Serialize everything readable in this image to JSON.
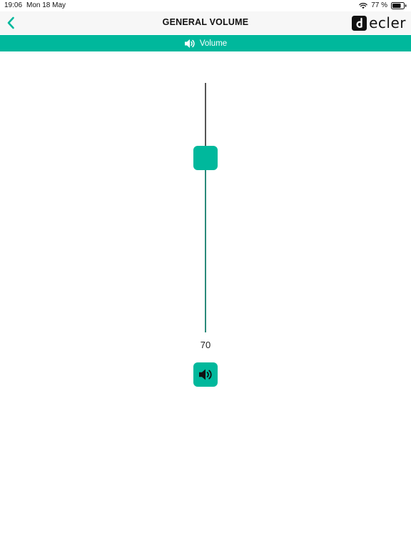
{
  "status_bar": {
    "time": "19:06",
    "date": "Mon 18 May",
    "battery_text": "77 %",
    "battery_level": 0.77,
    "icons": [
      "wifi-icon",
      "battery-icon"
    ]
  },
  "nav": {
    "back_icon": "chevron-left-icon",
    "title": "GENERAL VOLUME",
    "brand_name": "ecler",
    "brand_icon": "ecler-logo-icon"
  },
  "tab": {
    "icon": "speaker-icon",
    "label": "Volume"
  },
  "volume": {
    "value": "70",
    "level_percent": 70,
    "mute_icon": "speaker-icon"
  },
  "colors": {
    "accent": "#00b89c",
    "track": "#555555",
    "track_fill": "#2b8a7a",
    "nav_bg": "#f7f7f7"
  }
}
